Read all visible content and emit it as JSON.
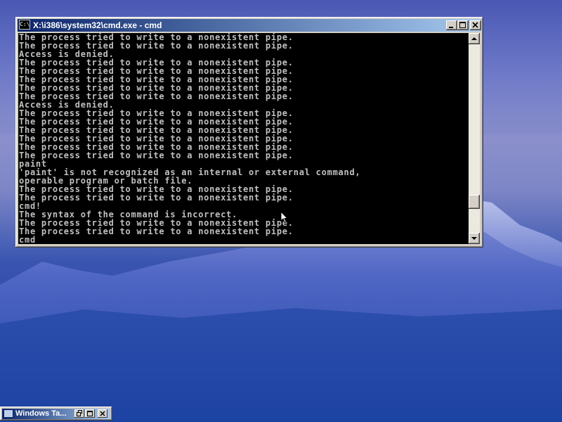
{
  "window": {
    "title": "X:\\i386\\system32\\cmd.exe - cmd",
    "icon": "console-icon",
    "icon_text": "C:\\"
  },
  "console": {
    "lines": [
      "The process tried to write to a nonexistent pipe.",
      "The process tried to write to a nonexistent pipe.",
      "Access is denied.",
      "The process tried to write to a nonexistent pipe.",
      "The process tried to write to a nonexistent pipe.",
      "The process tried to write to a nonexistent pipe.",
      "The process tried to write to a nonexistent pipe.",
      "The process tried to write to a nonexistent pipe.",
      "Access is denied.",
      "The process tried to write to a nonexistent pipe.",
      "The process tried to write to a nonexistent pipe.",
      "The process tried to write to a nonexistent pipe.",
      "The process tried to write to a nonexistent pipe.",
      "The process tried to write to a nonexistent pipe.",
      "The process tried to write to a nonexistent pipe.",
      "paint",
      "'paint' is not recognized as an internal or external command,",
      "operable program or batch file.",
      "The process tried to write to a nonexistent pipe.",
      "The process tried to write to a nonexistent pipe.",
      "cmd!",
      "The syntax of the command is incorrect.",
      "The process tried to write to a nonexistent pipe.",
      "The process tried to write to a nonexistent pipe.",
      "cmd"
    ],
    "text_color": "#c0c0c0",
    "background": "#000000"
  },
  "taskbar_window": {
    "title": "Windows Ta..."
  },
  "colors": {
    "titlebar_start": "#0a246a",
    "titlebar_end": "#a6caf0",
    "chrome": "#d4d0c8"
  }
}
